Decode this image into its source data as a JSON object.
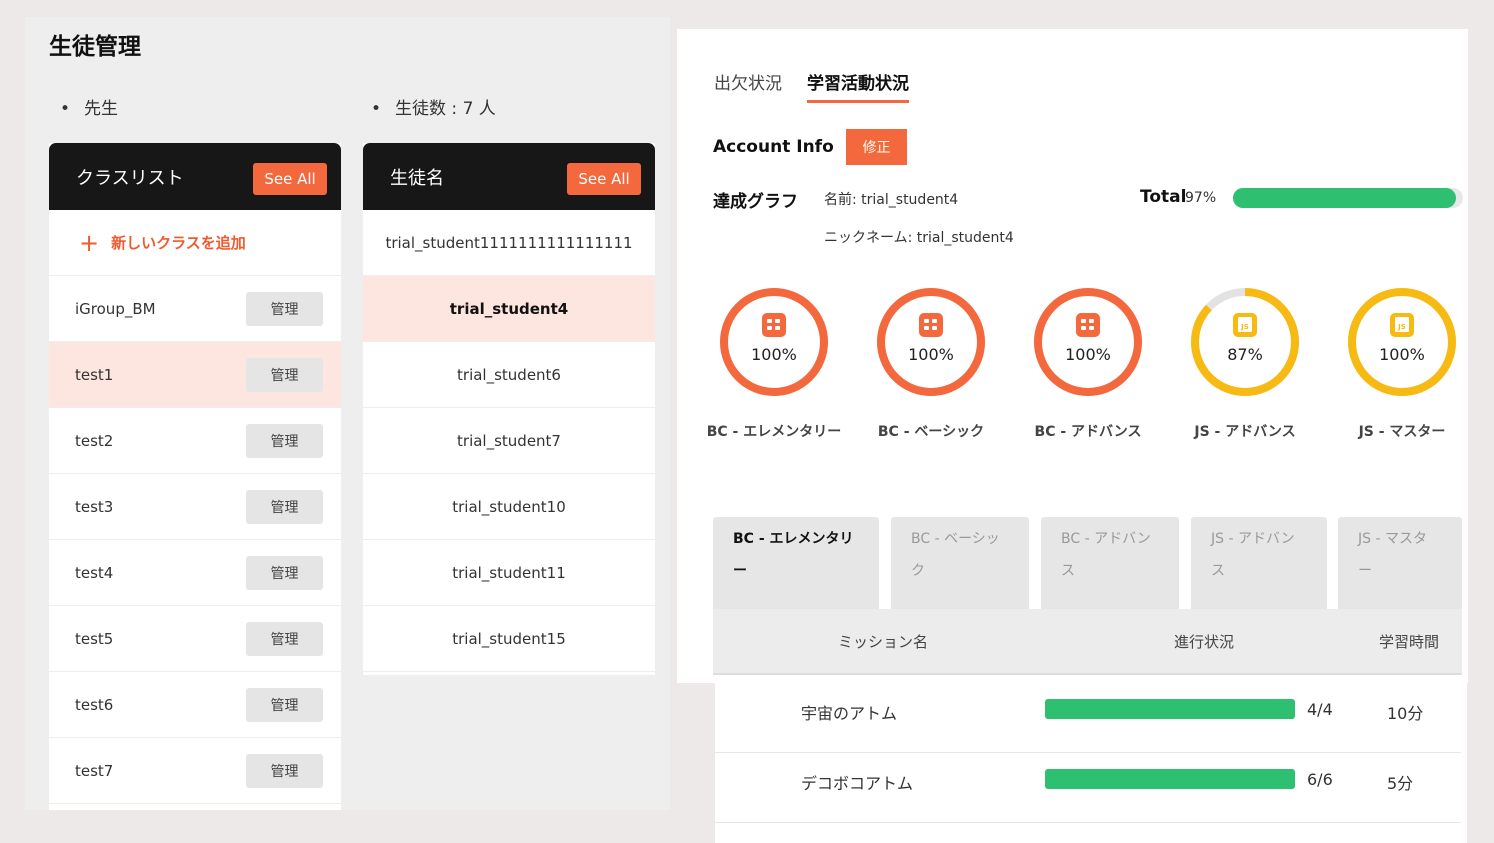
{
  "left": {
    "title": "生徒管理",
    "teacher_label": "先生",
    "student_count_label": "生徒数 : 7 人"
  },
  "class_list": {
    "title": "クラスリスト",
    "see_all": "See All",
    "add_label": "新しいクラスを追加",
    "manage_label": "管理",
    "items": [
      {
        "name": "iGroup_BM"
      },
      {
        "name": "test1"
      },
      {
        "name": "test2"
      },
      {
        "name": "test3"
      },
      {
        "name": "test4"
      },
      {
        "name": "test5"
      },
      {
        "name": "test6"
      },
      {
        "name": "test7"
      }
    ]
  },
  "student_list": {
    "title": "生徒名",
    "see_all": "See All",
    "items": [
      "trial_student1111111111111111",
      "trial_student4",
      "trial_student6",
      "trial_student7",
      "trial_student10",
      "trial_student11",
      "trial_student15"
    ]
  },
  "right": {
    "tabs": [
      "出欠状況",
      "学習活動状況"
    ],
    "account_info": "Account Info",
    "edit_label": "修正",
    "achievement_label": "達成グラフ",
    "name_line": "名前: trial_student4",
    "nick_line": "ニックネーム: trial_student4",
    "total_label": "Total",
    "total_pct": "97%",
    "total_value": 0.97,
    "colors": {
      "accent": "#f4683d",
      "bc": "#f4683d",
      "js": "#f6ba12",
      "progress": "#2fbf71"
    },
    "courses": [
      {
        "name": "BC - エレメンタリー",
        "pct": "100%",
        "value": 1.0,
        "icon": "bc-icon",
        "kind": "bc"
      },
      {
        "name": "BC - ベーシック",
        "pct": "100%",
        "value": 1.0,
        "icon": "bc-icon",
        "kind": "bc"
      },
      {
        "name": "BC - アドバンス",
        "pct": "100%",
        "value": 1.0,
        "icon": "bc-icon",
        "kind": "bc"
      },
      {
        "name": "JS - アドバンス",
        "pct": "87%",
        "value": 0.87,
        "icon": "js-icon",
        "kind": "js"
      },
      {
        "name": "JS - マスター",
        "pct": "100%",
        "value": 1.0,
        "icon": "js-icon",
        "kind": "js"
      }
    ],
    "course_tabs": [
      {
        "line1": "BC - エレメンタリ",
        "line2": "ー"
      },
      {
        "line1": "BC - ベーシッ",
        "line2": "ク"
      },
      {
        "line1": "BC - アドバン",
        "line2": "ス"
      },
      {
        "line1": "JS - アドバン",
        "line2": "ス"
      },
      {
        "line1": "JS - マスタ",
        "line2": "ー"
      }
    ],
    "table_headers": {
      "mission": "ミッション名",
      "progress": "進行状況",
      "time": "学習時間"
    },
    "missions": [
      {
        "name": "宇宙のアトム",
        "progress": "4/4",
        "value": 1.0,
        "time": "10分"
      },
      {
        "name": "デコボコアトム",
        "progress": "6/6",
        "value": 1.0,
        "time": "5分"
      }
    ]
  }
}
